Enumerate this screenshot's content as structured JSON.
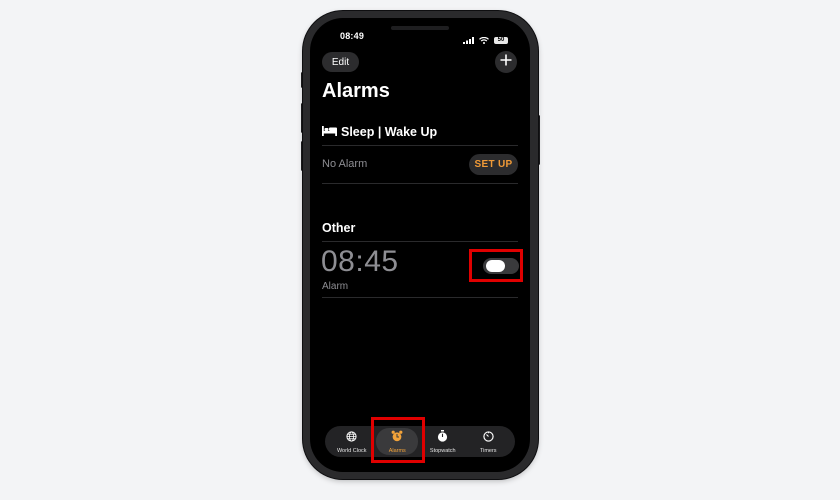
{
  "status_bar": {
    "time": "08:49",
    "battery": "50"
  },
  "header": {
    "edit_label": "Edit",
    "title": "Alarms"
  },
  "sleep_section": {
    "icon": "bed-icon",
    "title": "Sleep | Wake Up",
    "no_alarm": "No Alarm",
    "setup_label": "SET UP"
  },
  "other_section": {
    "title": "Other",
    "alarms": [
      {
        "time": "08:45",
        "label": "Alarm",
        "enabled": false
      }
    ]
  },
  "tabs": [
    {
      "label": "World Clock",
      "icon": "globe-icon",
      "active": false
    },
    {
      "label": "Alarms",
      "icon": "alarm-clock-icon",
      "active": true
    },
    {
      "label": "Stopwatch",
      "icon": "stopwatch-icon",
      "active": false
    },
    {
      "label": "Timers",
      "icon": "timer-icon",
      "active": false
    }
  ],
  "colors": {
    "accent": "#f09a37",
    "highlight": "#e00000",
    "background": "#000000"
  }
}
